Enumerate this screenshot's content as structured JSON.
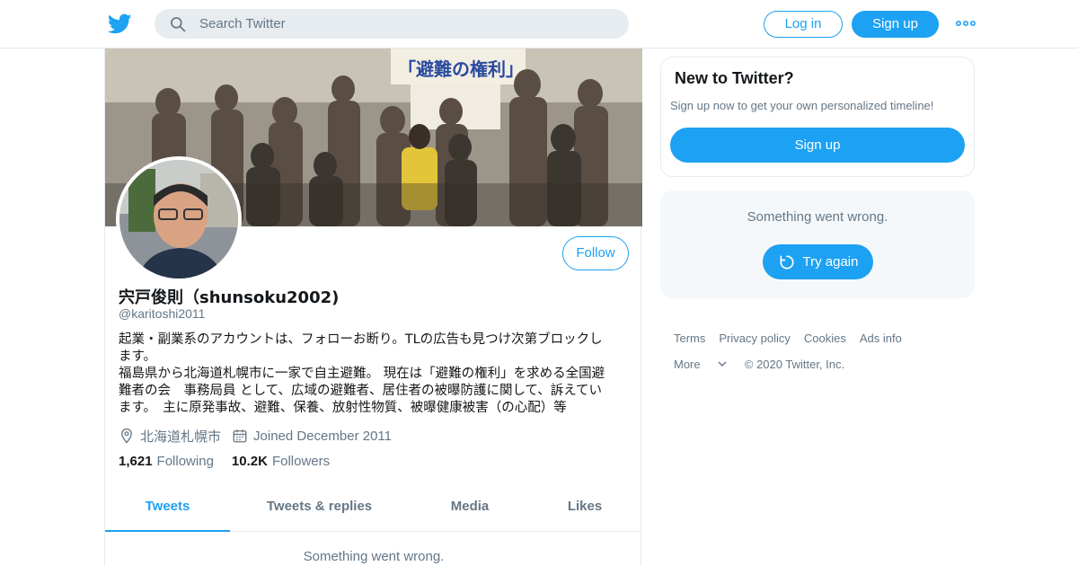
{
  "header": {
    "search_placeholder": "Search Twitter",
    "login_label": "Log in",
    "signup_label": "Sign up"
  },
  "profile": {
    "name": "宍戸俊則（shunsoku2002)",
    "handle": "@karitoshi2011",
    "follow_label": "Follow",
    "bio_lines": [
      "起業・副業系のアカウントは、フォローお断り。TLの広告も見つけ次第ブロックし",
      "ます。",
      "福島県から北海道札幌市に一家で自主避難。 現在は「避難の権利」を求める全国避",
      "難者の会　事務局員 として、広域の避難者、居住者の被曝防護に関して、訴えてい",
      "ます。　主に原発事故、避難、保養、放射性物質、被曝健康被害（の心配）等"
    ],
    "location": "北海道札幌市",
    "joined": "Joined December 2011",
    "following_count": "1,621",
    "following_label": "Following",
    "followers_count": "10.2K",
    "followers_label": "Followers",
    "tabs": [
      "Tweets",
      "Tweets & replies",
      "Media",
      "Likes"
    ],
    "error_text": "Something went wrong."
  },
  "sidebar": {
    "new_title": "New to Twitter?",
    "new_subtitle": "Sign up now to get your own personalized timeline!",
    "signup_label": "Sign up",
    "error_text": "Something went wrong.",
    "retry_label": "Try again"
  },
  "footer": {
    "links": [
      "Terms",
      "Privacy policy",
      "Cookies",
      "Ads info"
    ],
    "more_label": "More",
    "copyright": "© 2020 Twitter, Inc."
  },
  "banner_sign_text": "「避難の権利」",
  "colors": {
    "accent": "#1da1f2",
    "muted_text": "#657786",
    "panel_bg": "#f5f8fa",
    "border": "#e6ecf0"
  },
  "icons": {
    "logo": "twitter-bird-icon",
    "search": "search-icon",
    "more": "more-dots-icon",
    "location": "location-pin-icon",
    "calendar": "calendar-icon",
    "retry": "refresh-icon",
    "chevron": "chevron-down-icon"
  }
}
